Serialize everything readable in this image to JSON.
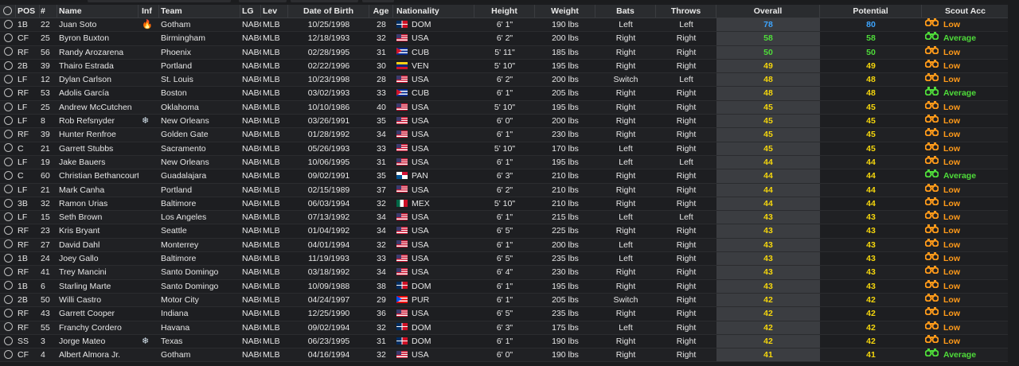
{
  "colors": {
    "rating_blue": "#3da5ff",
    "rating_green": "#4fdc3a",
    "rating_yellow": "#f5d60c",
    "scout_low": "#ff9a1a",
    "scout_average": "#4fdc3a"
  },
  "columns": {
    "pos": "POS",
    "num": "#",
    "name": "Name",
    "inf": "Inf",
    "team": "Team",
    "lg": "LG",
    "lev": "Lev",
    "dob": "Date of Birth",
    "age": "Age",
    "nat": "Nationality",
    "height": "Height",
    "weight": "Weight",
    "bats": "Bats",
    "throws": "Throws",
    "overall": "Overall",
    "potential": "Potential",
    "scout": "Scout Acc"
  },
  "players": [
    {
      "pos": "1B",
      "num": "22",
      "name": "Juan Soto",
      "inf": "fire-icon",
      "team": "Gotham",
      "lg": "NABC",
      "lev": "MLB",
      "dob": "10/25/1998",
      "age": "28",
      "nat": "DOM",
      "flag": "dom",
      "height": "6' 1\"",
      "weight": "190 lbs",
      "bats": "Left",
      "throws": "Left",
      "ovr": "78",
      "ovr_color": "blue",
      "pot": "80",
      "pot_color": "blue",
      "scout": "Low"
    },
    {
      "pos": "CF",
      "num": "25",
      "name": "Byron Buxton",
      "inf": "",
      "team": "Birmingham",
      "lg": "NABC",
      "lev": "MLB",
      "dob": "12/18/1993",
      "age": "32",
      "nat": "USA",
      "flag": "usa",
      "height": "6' 2\"",
      "weight": "200 lbs",
      "bats": "Right",
      "throws": "Right",
      "ovr": "58",
      "ovr_color": "green",
      "pot": "58",
      "pot_color": "green",
      "scout": "Average"
    },
    {
      "pos": "RF",
      "num": "56",
      "name": "Randy Arozarena",
      "inf": "",
      "team": "Phoenix",
      "lg": "NABC",
      "lev": "MLB",
      "dob": "02/28/1995",
      "age": "31",
      "nat": "CUB",
      "flag": "cub",
      "height": "5' 11\"",
      "weight": "185 lbs",
      "bats": "Right",
      "throws": "Right",
      "ovr": "50",
      "ovr_color": "green",
      "pot": "50",
      "pot_color": "green",
      "scout": "Low"
    },
    {
      "pos": "2B",
      "num": "39",
      "name": "Thairo Estrada",
      "inf": "",
      "team": "Portland",
      "lg": "NABC",
      "lev": "MLB",
      "dob": "02/22/1996",
      "age": "30",
      "nat": "VEN",
      "flag": "ven",
      "height": "5' 10\"",
      "weight": "195 lbs",
      "bats": "Right",
      "throws": "Right",
      "ovr": "49",
      "ovr_color": "yellow",
      "pot": "49",
      "pot_color": "yellow",
      "scout": "Low"
    },
    {
      "pos": "LF",
      "num": "12",
      "name": "Dylan Carlson",
      "inf": "",
      "team": "St. Louis",
      "lg": "NABC",
      "lev": "MLB",
      "dob": "10/23/1998",
      "age": "28",
      "nat": "USA",
      "flag": "usa",
      "height": "6' 2\"",
      "weight": "200 lbs",
      "bats": "Switch",
      "throws": "Left",
      "ovr": "48",
      "ovr_color": "yellow",
      "pot": "48",
      "pot_color": "yellow",
      "scout": "Low"
    },
    {
      "pos": "RF",
      "num": "53",
      "name": "Adolis García",
      "inf": "",
      "team": "Boston",
      "lg": "NABC",
      "lev": "MLB",
      "dob": "03/02/1993",
      "age": "33",
      "nat": "CUB",
      "flag": "cub",
      "height": "6' 1\"",
      "weight": "205 lbs",
      "bats": "Right",
      "throws": "Right",
      "ovr": "48",
      "ovr_color": "yellow",
      "pot": "48",
      "pot_color": "yellow",
      "scout": "Average"
    },
    {
      "pos": "LF",
      "num": "25",
      "name": "Andrew McCutchen",
      "inf": "",
      "team": "Oklahoma",
      "lg": "NABC",
      "lev": "MLB",
      "dob": "10/10/1986",
      "age": "40",
      "nat": "USA",
      "flag": "usa",
      "height": "5' 10\"",
      "weight": "195 lbs",
      "bats": "Right",
      "throws": "Right",
      "ovr": "45",
      "ovr_color": "yellow",
      "pot": "45",
      "pot_color": "yellow",
      "scout": "Low"
    },
    {
      "pos": "LF",
      "num": "8",
      "name": "Rob Refsnyder",
      "inf": "snowflake-icon",
      "team": "New Orleans",
      "lg": "NABC",
      "lev": "MLB",
      "dob": "03/26/1991",
      "age": "35",
      "nat": "USA",
      "flag": "usa",
      "height": "6' 0\"",
      "weight": "200 lbs",
      "bats": "Right",
      "throws": "Right",
      "ovr": "45",
      "ovr_color": "yellow",
      "pot": "45",
      "pot_color": "yellow",
      "scout": "Low"
    },
    {
      "pos": "RF",
      "num": "39",
      "name": "Hunter Renfroe",
      "inf": "",
      "team": "Golden Gate",
      "lg": "NABC",
      "lev": "MLB",
      "dob": "01/28/1992",
      "age": "34",
      "nat": "USA",
      "flag": "usa",
      "height": "6' 1\"",
      "weight": "230 lbs",
      "bats": "Right",
      "throws": "Right",
      "ovr": "45",
      "ovr_color": "yellow",
      "pot": "45",
      "pot_color": "yellow",
      "scout": "Low"
    },
    {
      "pos": "C",
      "num": "21",
      "name": "Garrett Stubbs",
      "inf": "",
      "team": "Sacramento",
      "lg": "NABC",
      "lev": "MLB",
      "dob": "05/26/1993",
      "age": "33",
      "nat": "USA",
      "flag": "usa",
      "height": "5' 10\"",
      "weight": "170 lbs",
      "bats": "Left",
      "throws": "Right",
      "ovr": "45",
      "ovr_color": "yellow",
      "pot": "45",
      "pot_color": "yellow",
      "scout": "Low"
    },
    {
      "pos": "LF",
      "num": "19",
      "name": "Jake Bauers",
      "inf": "",
      "team": "New Orleans",
      "lg": "NABC",
      "lev": "MLB",
      "dob": "10/06/1995",
      "age": "31",
      "nat": "USA",
      "flag": "usa",
      "height": "6' 1\"",
      "weight": "195 lbs",
      "bats": "Left",
      "throws": "Left",
      "ovr": "44",
      "ovr_color": "yellow",
      "pot": "44",
      "pot_color": "yellow",
      "scout": "Low"
    },
    {
      "pos": "C",
      "num": "60",
      "name": "Christian Bethancourt",
      "inf": "",
      "team": "Guadalajara",
      "lg": "NABC",
      "lev": "MLB",
      "dob": "09/02/1991",
      "age": "35",
      "nat": "PAN",
      "flag": "pan",
      "height": "6' 3\"",
      "weight": "210 lbs",
      "bats": "Right",
      "throws": "Right",
      "ovr": "44",
      "ovr_color": "yellow",
      "pot": "44",
      "pot_color": "yellow",
      "scout": "Average"
    },
    {
      "pos": "LF",
      "num": "21",
      "name": "Mark Canha",
      "inf": "",
      "team": "Portland",
      "lg": "NABC",
      "lev": "MLB",
      "dob": "02/15/1989",
      "age": "37",
      "nat": "USA",
      "flag": "usa",
      "height": "6' 2\"",
      "weight": "210 lbs",
      "bats": "Right",
      "throws": "Right",
      "ovr": "44",
      "ovr_color": "yellow",
      "pot": "44",
      "pot_color": "yellow",
      "scout": "Low"
    },
    {
      "pos": "3B",
      "num": "32",
      "name": "Ramon Urias",
      "inf": "",
      "team": "Baltimore",
      "lg": "NABC",
      "lev": "MLB",
      "dob": "06/03/1994",
      "age": "32",
      "nat": "MEX",
      "flag": "mex",
      "height": "5' 10\"",
      "weight": "210 lbs",
      "bats": "Right",
      "throws": "Right",
      "ovr": "44",
      "ovr_color": "yellow",
      "pot": "44",
      "pot_color": "yellow",
      "scout": "Low"
    },
    {
      "pos": "LF",
      "num": "15",
      "name": "Seth Brown",
      "inf": "",
      "team": "Los Angeles",
      "lg": "NABC",
      "lev": "MLB",
      "dob": "07/13/1992",
      "age": "34",
      "nat": "USA",
      "flag": "usa",
      "height": "6' 1\"",
      "weight": "215 lbs",
      "bats": "Left",
      "throws": "Left",
      "ovr": "43",
      "ovr_color": "yellow",
      "pot": "43",
      "pot_color": "yellow",
      "scout": "Low"
    },
    {
      "pos": "RF",
      "num": "23",
      "name": "Kris Bryant",
      "inf": "",
      "team": "Seattle",
      "lg": "NABC",
      "lev": "MLB",
      "dob": "01/04/1992",
      "age": "34",
      "nat": "USA",
      "flag": "usa",
      "height": "6' 5\"",
      "weight": "225 lbs",
      "bats": "Right",
      "throws": "Right",
      "ovr": "43",
      "ovr_color": "yellow",
      "pot": "43",
      "pot_color": "yellow",
      "scout": "Low"
    },
    {
      "pos": "RF",
      "num": "27",
      "name": "David Dahl",
      "inf": "",
      "team": "Monterrey",
      "lg": "NABC",
      "lev": "MLB",
      "dob": "04/01/1994",
      "age": "32",
      "nat": "USA",
      "flag": "usa",
      "height": "6' 1\"",
      "weight": "200 lbs",
      "bats": "Left",
      "throws": "Right",
      "ovr": "43",
      "ovr_color": "yellow",
      "pot": "43",
      "pot_color": "yellow",
      "scout": "Low"
    },
    {
      "pos": "1B",
      "num": "24",
      "name": "Joey Gallo",
      "inf": "",
      "team": "Baltimore",
      "lg": "NABC",
      "lev": "MLB",
      "dob": "11/19/1993",
      "age": "33",
      "nat": "USA",
      "flag": "usa",
      "height": "6' 5\"",
      "weight": "235 lbs",
      "bats": "Left",
      "throws": "Right",
      "ovr": "43",
      "ovr_color": "yellow",
      "pot": "43",
      "pot_color": "yellow",
      "scout": "Low"
    },
    {
      "pos": "RF",
      "num": "41",
      "name": "Trey Mancini",
      "inf": "",
      "team": "Santo Domingo",
      "lg": "NABC",
      "lev": "MLB",
      "dob": "03/18/1992",
      "age": "34",
      "nat": "USA",
      "flag": "usa",
      "height": "6' 4\"",
      "weight": "230 lbs",
      "bats": "Right",
      "throws": "Right",
      "ovr": "43",
      "ovr_color": "yellow",
      "pot": "43",
      "pot_color": "yellow",
      "scout": "Low"
    },
    {
      "pos": "1B",
      "num": "6",
      "name": "Starling Marte",
      "inf": "",
      "team": "Santo Domingo",
      "lg": "NABC",
      "lev": "MLB",
      "dob": "10/09/1988",
      "age": "38",
      "nat": "DOM",
      "flag": "dom",
      "height": "6' 1\"",
      "weight": "195 lbs",
      "bats": "Right",
      "throws": "Right",
      "ovr": "43",
      "ovr_color": "yellow",
      "pot": "43",
      "pot_color": "yellow",
      "scout": "Low"
    },
    {
      "pos": "2B",
      "num": "50",
      "name": "Willi Castro",
      "inf": "",
      "team": "Motor City",
      "lg": "NABC",
      "lev": "MLB",
      "dob": "04/24/1997",
      "age": "29",
      "nat": "PUR",
      "flag": "pur",
      "height": "6' 1\"",
      "weight": "205 lbs",
      "bats": "Switch",
      "throws": "Right",
      "ovr": "42",
      "ovr_color": "yellow",
      "pot": "42",
      "pot_color": "yellow",
      "scout": "Low"
    },
    {
      "pos": "RF",
      "num": "43",
      "name": "Garrett Cooper",
      "inf": "",
      "team": "Indiana",
      "lg": "NABC",
      "lev": "MLB",
      "dob": "12/25/1990",
      "age": "36",
      "nat": "USA",
      "flag": "usa",
      "height": "6' 5\"",
      "weight": "235 lbs",
      "bats": "Right",
      "throws": "Right",
      "ovr": "42",
      "ovr_color": "yellow",
      "pot": "42",
      "pot_color": "yellow",
      "scout": "Low"
    },
    {
      "pos": "RF",
      "num": "55",
      "name": "Franchy Cordero",
      "inf": "",
      "team": "Havana",
      "lg": "NABC",
      "lev": "MLB",
      "dob": "09/02/1994",
      "age": "32",
      "nat": "DOM",
      "flag": "dom",
      "height": "6' 3\"",
      "weight": "175 lbs",
      "bats": "Left",
      "throws": "Right",
      "ovr": "42",
      "ovr_color": "yellow",
      "pot": "42",
      "pot_color": "yellow",
      "scout": "Low"
    },
    {
      "pos": "SS",
      "num": "3",
      "name": "Jorge Mateo",
      "inf": "snowflake-icon",
      "team": "Texas",
      "lg": "NABC",
      "lev": "MLB",
      "dob": "06/23/1995",
      "age": "31",
      "nat": "DOM",
      "flag": "dom",
      "height": "6' 1\"",
      "weight": "190 lbs",
      "bats": "Right",
      "throws": "Right",
      "ovr": "42",
      "ovr_color": "yellow",
      "pot": "42",
      "pot_color": "yellow",
      "scout": "Low"
    },
    {
      "pos": "CF",
      "num": "4",
      "name": "Albert Almora Jr.",
      "inf": "",
      "team": "Gotham",
      "lg": "NABC",
      "lev": "MLB",
      "dob": "04/16/1994",
      "age": "32",
      "nat": "USA",
      "flag": "usa",
      "height": "6' 0\"",
      "weight": "190 lbs",
      "bats": "Right",
      "throws": "Right",
      "ovr": "41",
      "ovr_color": "yellow",
      "pot": "41",
      "pot_color": "yellow",
      "scout": "Average"
    }
  ]
}
